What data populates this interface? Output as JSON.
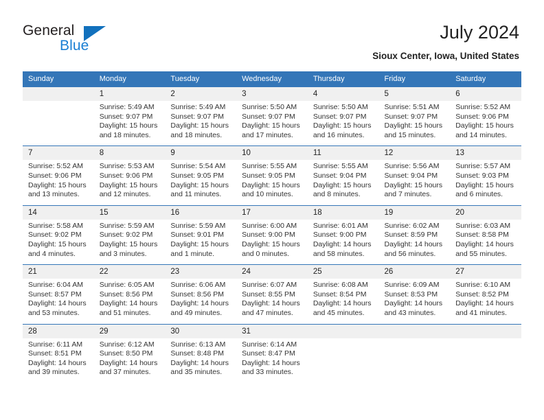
{
  "brand": {
    "name_primary": "General",
    "name_secondary": "Blue",
    "accent_color": "#1271bd",
    "secondary_color": "#1a7fd4",
    "logo_icon": "triangle-icon"
  },
  "header": {
    "title": "July 2024",
    "subtitle": "Sioux Center, Iowa, United States"
  },
  "calendar": {
    "header_bg": "#3476b8",
    "daynum_bg": "#f0f0f0",
    "weekdays": [
      "Sunday",
      "Monday",
      "Tuesday",
      "Wednesday",
      "Thursday",
      "Friday",
      "Saturday"
    ],
    "weeks": [
      [
        {
          "day": "",
          "sunrise": "",
          "sunset": "",
          "daylight_1": "",
          "daylight_2": ""
        },
        {
          "day": "1",
          "sunrise": "Sunrise: 5:49 AM",
          "sunset": "Sunset: 9:07 PM",
          "daylight_1": "Daylight: 15 hours",
          "daylight_2": "and 18 minutes."
        },
        {
          "day": "2",
          "sunrise": "Sunrise: 5:49 AM",
          "sunset": "Sunset: 9:07 PM",
          "daylight_1": "Daylight: 15 hours",
          "daylight_2": "and 18 minutes."
        },
        {
          "day": "3",
          "sunrise": "Sunrise: 5:50 AM",
          "sunset": "Sunset: 9:07 PM",
          "daylight_1": "Daylight: 15 hours",
          "daylight_2": "and 17 minutes."
        },
        {
          "day": "4",
          "sunrise": "Sunrise: 5:50 AM",
          "sunset": "Sunset: 9:07 PM",
          "daylight_1": "Daylight: 15 hours",
          "daylight_2": "and 16 minutes."
        },
        {
          "day": "5",
          "sunrise": "Sunrise: 5:51 AM",
          "sunset": "Sunset: 9:07 PM",
          "daylight_1": "Daylight: 15 hours",
          "daylight_2": "and 15 minutes."
        },
        {
          "day": "6",
          "sunrise": "Sunrise: 5:52 AM",
          "sunset": "Sunset: 9:06 PM",
          "daylight_1": "Daylight: 15 hours",
          "daylight_2": "and 14 minutes."
        }
      ],
      [
        {
          "day": "7",
          "sunrise": "Sunrise: 5:52 AM",
          "sunset": "Sunset: 9:06 PM",
          "daylight_1": "Daylight: 15 hours",
          "daylight_2": "and 13 minutes."
        },
        {
          "day": "8",
          "sunrise": "Sunrise: 5:53 AM",
          "sunset": "Sunset: 9:06 PM",
          "daylight_1": "Daylight: 15 hours",
          "daylight_2": "and 12 minutes."
        },
        {
          "day": "9",
          "sunrise": "Sunrise: 5:54 AM",
          "sunset": "Sunset: 9:05 PM",
          "daylight_1": "Daylight: 15 hours",
          "daylight_2": "and 11 minutes."
        },
        {
          "day": "10",
          "sunrise": "Sunrise: 5:55 AM",
          "sunset": "Sunset: 9:05 PM",
          "daylight_1": "Daylight: 15 hours",
          "daylight_2": "and 10 minutes."
        },
        {
          "day": "11",
          "sunrise": "Sunrise: 5:55 AM",
          "sunset": "Sunset: 9:04 PM",
          "daylight_1": "Daylight: 15 hours",
          "daylight_2": "and 8 minutes."
        },
        {
          "day": "12",
          "sunrise": "Sunrise: 5:56 AM",
          "sunset": "Sunset: 9:04 PM",
          "daylight_1": "Daylight: 15 hours",
          "daylight_2": "and 7 minutes."
        },
        {
          "day": "13",
          "sunrise": "Sunrise: 5:57 AM",
          "sunset": "Sunset: 9:03 PM",
          "daylight_1": "Daylight: 15 hours",
          "daylight_2": "and 6 minutes."
        }
      ],
      [
        {
          "day": "14",
          "sunrise": "Sunrise: 5:58 AM",
          "sunset": "Sunset: 9:02 PM",
          "daylight_1": "Daylight: 15 hours",
          "daylight_2": "and 4 minutes."
        },
        {
          "day": "15",
          "sunrise": "Sunrise: 5:59 AM",
          "sunset": "Sunset: 9:02 PM",
          "daylight_1": "Daylight: 15 hours",
          "daylight_2": "and 3 minutes."
        },
        {
          "day": "16",
          "sunrise": "Sunrise: 5:59 AM",
          "sunset": "Sunset: 9:01 PM",
          "daylight_1": "Daylight: 15 hours",
          "daylight_2": "and 1 minute."
        },
        {
          "day": "17",
          "sunrise": "Sunrise: 6:00 AM",
          "sunset": "Sunset: 9:00 PM",
          "daylight_1": "Daylight: 15 hours",
          "daylight_2": "and 0 minutes."
        },
        {
          "day": "18",
          "sunrise": "Sunrise: 6:01 AM",
          "sunset": "Sunset: 9:00 PM",
          "daylight_1": "Daylight: 14 hours",
          "daylight_2": "and 58 minutes."
        },
        {
          "day": "19",
          "sunrise": "Sunrise: 6:02 AM",
          "sunset": "Sunset: 8:59 PM",
          "daylight_1": "Daylight: 14 hours",
          "daylight_2": "and 56 minutes."
        },
        {
          "day": "20",
          "sunrise": "Sunrise: 6:03 AM",
          "sunset": "Sunset: 8:58 PM",
          "daylight_1": "Daylight: 14 hours",
          "daylight_2": "and 55 minutes."
        }
      ],
      [
        {
          "day": "21",
          "sunrise": "Sunrise: 6:04 AM",
          "sunset": "Sunset: 8:57 PM",
          "daylight_1": "Daylight: 14 hours",
          "daylight_2": "and 53 minutes."
        },
        {
          "day": "22",
          "sunrise": "Sunrise: 6:05 AM",
          "sunset": "Sunset: 8:56 PM",
          "daylight_1": "Daylight: 14 hours",
          "daylight_2": "and 51 minutes."
        },
        {
          "day": "23",
          "sunrise": "Sunrise: 6:06 AM",
          "sunset": "Sunset: 8:56 PM",
          "daylight_1": "Daylight: 14 hours",
          "daylight_2": "and 49 minutes."
        },
        {
          "day": "24",
          "sunrise": "Sunrise: 6:07 AM",
          "sunset": "Sunset: 8:55 PM",
          "daylight_1": "Daylight: 14 hours",
          "daylight_2": "and 47 minutes."
        },
        {
          "day": "25",
          "sunrise": "Sunrise: 6:08 AM",
          "sunset": "Sunset: 8:54 PM",
          "daylight_1": "Daylight: 14 hours",
          "daylight_2": "and 45 minutes."
        },
        {
          "day": "26",
          "sunrise": "Sunrise: 6:09 AM",
          "sunset": "Sunset: 8:53 PM",
          "daylight_1": "Daylight: 14 hours",
          "daylight_2": "and 43 minutes."
        },
        {
          "day": "27",
          "sunrise": "Sunrise: 6:10 AM",
          "sunset": "Sunset: 8:52 PM",
          "daylight_1": "Daylight: 14 hours",
          "daylight_2": "and 41 minutes."
        }
      ],
      [
        {
          "day": "28",
          "sunrise": "Sunrise: 6:11 AM",
          "sunset": "Sunset: 8:51 PM",
          "daylight_1": "Daylight: 14 hours",
          "daylight_2": "and 39 minutes."
        },
        {
          "day": "29",
          "sunrise": "Sunrise: 6:12 AM",
          "sunset": "Sunset: 8:50 PM",
          "daylight_1": "Daylight: 14 hours",
          "daylight_2": "and 37 minutes."
        },
        {
          "day": "30",
          "sunrise": "Sunrise: 6:13 AM",
          "sunset": "Sunset: 8:48 PM",
          "daylight_1": "Daylight: 14 hours",
          "daylight_2": "and 35 minutes."
        },
        {
          "day": "31",
          "sunrise": "Sunrise: 6:14 AM",
          "sunset": "Sunset: 8:47 PM",
          "daylight_1": "Daylight: 14 hours",
          "daylight_2": "and 33 minutes."
        },
        {
          "day": "",
          "sunrise": "",
          "sunset": "",
          "daylight_1": "",
          "daylight_2": ""
        },
        {
          "day": "",
          "sunrise": "",
          "sunset": "",
          "daylight_1": "",
          "daylight_2": ""
        },
        {
          "day": "",
          "sunrise": "",
          "sunset": "",
          "daylight_1": "",
          "daylight_2": ""
        }
      ]
    ]
  }
}
